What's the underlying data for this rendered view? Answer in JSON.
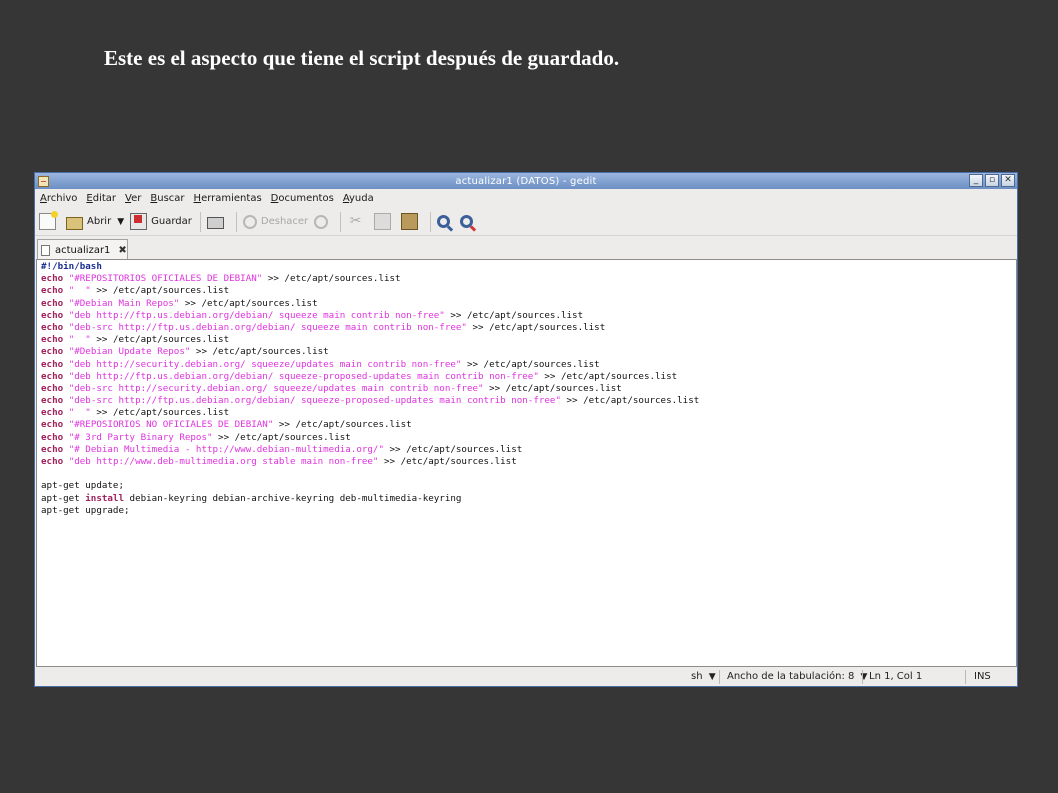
{
  "caption": "Este es el aspecto que tiene el script después de guardado.",
  "window": {
    "title": "actualizar1 (DATOS) - gedit",
    "controls": [
      "_",
      "▫",
      "✕"
    ]
  },
  "menu": [
    "Archivo",
    "Editar",
    "Ver",
    "Buscar",
    "Herramientas",
    "Documentos",
    "Ayuda"
  ],
  "toolbar": {
    "open_label": "Abrir",
    "save_label": "Guardar",
    "undo_label": "Deshacer"
  },
  "tab": {
    "label": "actualizar1"
  },
  "code": [
    [
      {
        "t": "#!/bin/bash",
        "c": "sheb"
      }
    ],
    [
      {
        "t": "echo",
        "c": "kw"
      },
      {
        "t": " "
      },
      {
        "t": "\"#REPOSITORIOS OFICIALES DE DEBIAN\"",
        "c": "str"
      },
      {
        "t": " >> /etc/apt/sources.list"
      }
    ],
    [
      {
        "t": "echo",
        "c": "kw"
      },
      {
        "t": " "
      },
      {
        "t": "\"  \"",
        "c": "str"
      },
      {
        "t": " >> /etc/apt/sources.list"
      }
    ],
    [
      {
        "t": "echo",
        "c": "kw"
      },
      {
        "t": " "
      },
      {
        "t": "\"#Debian Main Repos\"",
        "c": "str"
      },
      {
        "t": " >> /etc/apt/sources.list"
      }
    ],
    [
      {
        "t": "echo",
        "c": "kw"
      },
      {
        "t": " "
      },
      {
        "t": "\"deb http://ftp.us.debian.org/debian/ squeeze main contrib non-free\"",
        "c": "str"
      },
      {
        "t": " >> /etc/apt/sources.list"
      }
    ],
    [
      {
        "t": "echo",
        "c": "kw"
      },
      {
        "t": " "
      },
      {
        "t": "\"deb-src http://ftp.us.debian.org/debian/ squeeze main contrib non-free\"",
        "c": "str"
      },
      {
        "t": " >> /etc/apt/sources.list"
      }
    ],
    [
      {
        "t": "echo",
        "c": "kw"
      },
      {
        "t": " "
      },
      {
        "t": "\"  \"",
        "c": "str"
      },
      {
        "t": " >> /etc/apt/sources.list"
      }
    ],
    [
      {
        "t": "echo",
        "c": "kw"
      },
      {
        "t": " "
      },
      {
        "t": "\"#Debian Update Repos\"",
        "c": "str"
      },
      {
        "t": " >> /etc/apt/sources.list"
      }
    ],
    [
      {
        "t": "echo",
        "c": "kw"
      },
      {
        "t": " "
      },
      {
        "t": "\"deb http://security.debian.org/ squeeze/updates main contrib non-free\"",
        "c": "str"
      },
      {
        "t": " >> /etc/apt/sources.list"
      }
    ],
    [
      {
        "t": "echo",
        "c": "kw"
      },
      {
        "t": " "
      },
      {
        "t": "\"deb http://ftp.us.debian.org/debian/ squeeze-proposed-updates main contrib non-free\"",
        "c": "str"
      },
      {
        "t": " >> /etc/apt/sources.list"
      }
    ],
    [
      {
        "t": "echo",
        "c": "kw"
      },
      {
        "t": " "
      },
      {
        "t": "\"deb-src http://security.debian.org/ squeeze/updates main contrib non-free\"",
        "c": "str"
      },
      {
        "t": " >> /etc/apt/sources.list"
      }
    ],
    [
      {
        "t": "echo",
        "c": "kw"
      },
      {
        "t": " "
      },
      {
        "t": "\"deb-src http://ftp.us.debian.org/debian/ squeeze-proposed-updates main contrib non-free\"",
        "c": "str"
      },
      {
        "t": " >> /etc/apt/sources.list"
      }
    ],
    [
      {
        "t": "echo",
        "c": "kw"
      },
      {
        "t": " "
      },
      {
        "t": "\"  \"",
        "c": "str"
      },
      {
        "t": " >> /etc/apt/sources.list"
      }
    ],
    [
      {
        "t": "echo",
        "c": "kw"
      },
      {
        "t": " "
      },
      {
        "t": "\"#REPOSIORIOS NO OFICIALES DE DEBIAN\"",
        "c": "str"
      },
      {
        "t": " >> /etc/apt/sources.list"
      }
    ],
    [
      {
        "t": "echo",
        "c": "kw"
      },
      {
        "t": " "
      },
      {
        "t": "\"# 3rd Party Binary Repos\"",
        "c": "str"
      },
      {
        "t": " >> /etc/apt/sources.list"
      }
    ],
    [
      {
        "t": "echo",
        "c": "kw"
      },
      {
        "t": " "
      },
      {
        "t": "\"# Debian Multimedia - http://www.debian-multimedia.org/\"",
        "c": "str"
      },
      {
        "t": " >> /etc/apt/sources.list"
      }
    ],
    [
      {
        "t": "echo",
        "c": "kw"
      },
      {
        "t": " "
      },
      {
        "t": "\"deb http://www.deb-multimedia.org stable main non-free\"",
        "c": "str"
      },
      {
        "t": " >> /etc/apt/sources.list"
      }
    ],
    [],
    [
      {
        "t": "apt-get update;"
      }
    ],
    [
      {
        "t": "apt-get "
      },
      {
        "t": "install",
        "c": "kw"
      },
      {
        "t": " debian-keyring debian-archive-keyring deb-multimedia-keyring"
      }
    ],
    [
      {
        "t": "apt-get upgrade;"
      }
    ]
  ],
  "status": {
    "language": "sh",
    "tab_width": "Ancho de la tabulación: 8",
    "position": "Ln 1, Col 1",
    "mode": "INS"
  }
}
